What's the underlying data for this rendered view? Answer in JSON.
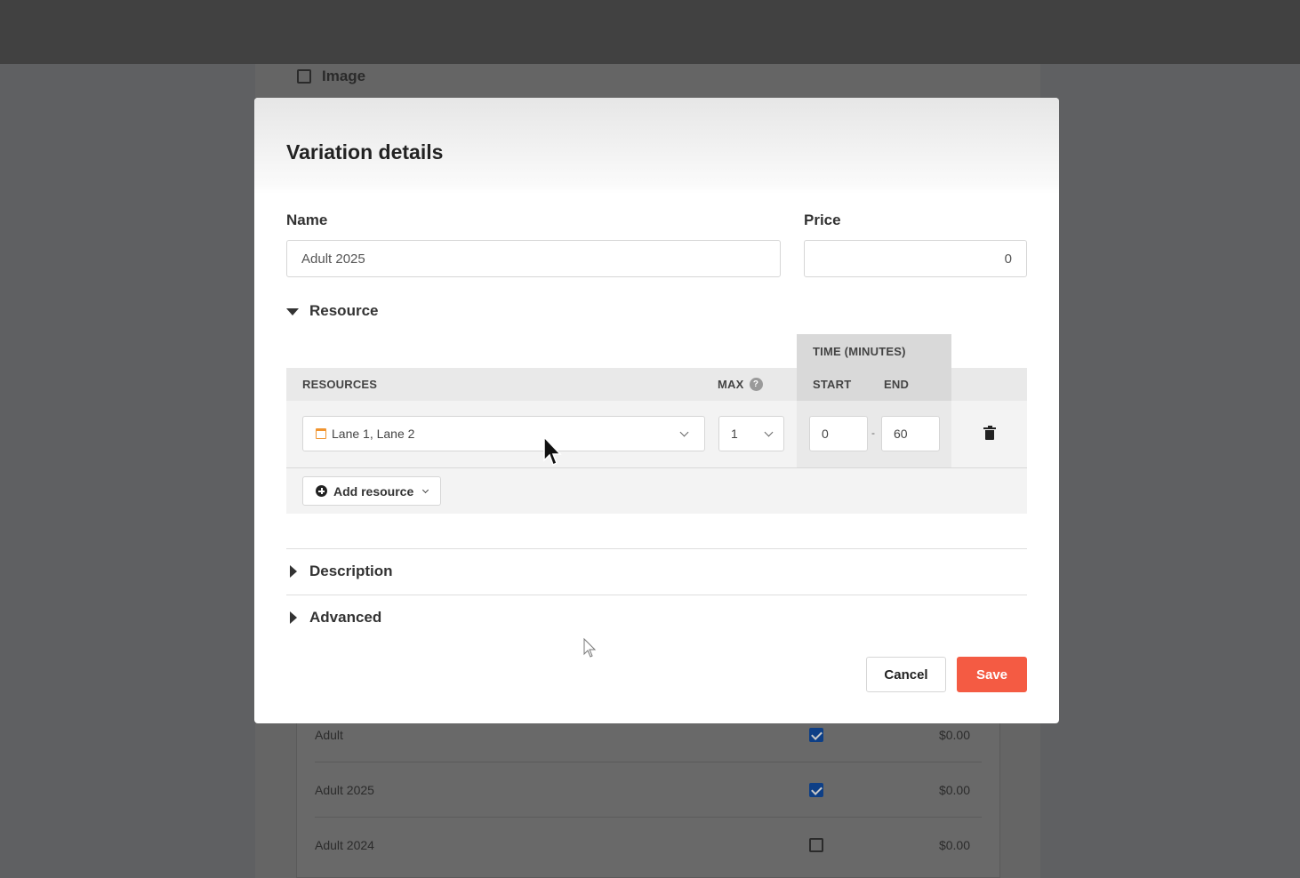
{
  "background": {
    "image_option_label": "Image",
    "rows": [
      {
        "name": "Adult",
        "checked": true,
        "price": "$0.00"
      },
      {
        "name": "Adult 2025",
        "checked": true,
        "price": "$0.00"
      },
      {
        "name": "Adult 2024",
        "checked": false,
        "price": "$0.00"
      }
    ]
  },
  "modal": {
    "title": "Variation details",
    "name_label": "Name",
    "name_value": "Adult 2025",
    "price_label": "Price",
    "price_value": "0",
    "resource_section": {
      "label": "Resource",
      "expanded": true,
      "columns": {
        "resources": "RESOURCES",
        "max": "MAX",
        "max_help": "?",
        "time_group": "TIME (MINUTES)",
        "start": "START",
        "end": "END"
      },
      "row": {
        "resources_value": "Lane 1, Lane 2",
        "max_value": "1",
        "start_value": "0",
        "separator": "-",
        "end_value": "60"
      },
      "add_button_label": "Add resource"
    },
    "description_section": {
      "label": "Description",
      "expanded": false
    },
    "advanced_section": {
      "label": "Advanced",
      "expanded": false
    },
    "cancel_label": "Cancel",
    "save_label": "Save"
  },
  "colors": {
    "save_button": "#f45b43",
    "calendar_icon": "#f0942f",
    "checkbox_checked": "#0e3f86"
  },
  "icons": [
    "calendar-icon",
    "chevron-down-icon",
    "help-icon",
    "trash-icon",
    "plus-circle-icon",
    "caret-down-icon",
    "caret-right-icon",
    "mouse-pointer-icon"
  ]
}
